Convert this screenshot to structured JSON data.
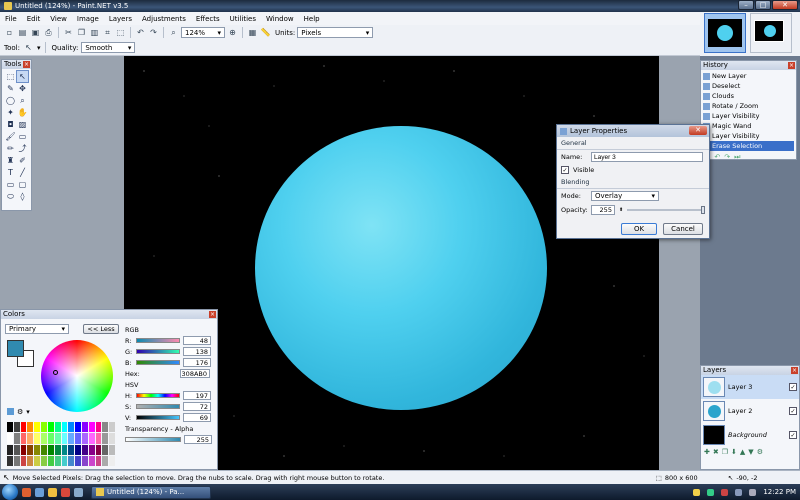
{
  "window": {
    "title": "Untitled (124%) - Paint.NET v3.5",
    "min": "–",
    "max": "□",
    "close": "✕"
  },
  "menu": [
    "File",
    "Edit",
    "View",
    "Image",
    "Layers",
    "Adjustments",
    "Effects",
    "Utilities",
    "Window",
    "Help"
  ],
  "toolbar": {
    "zoom": "124%",
    "units_label": "Units:",
    "units_value": "Pixels"
  },
  "toolbar2": {
    "tool_label": "Tool:",
    "quality_label": "Quality:",
    "quality_value": "Smooth"
  },
  "tools": {
    "title": "Tools"
  },
  "history": {
    "title": "History",
    "items": [
      "New Layer",
      "Deselect",
      "Clouds",
      "Rotate / Zoom",
      "Layer Visibility",
      "Magic Wand",
      "Layer Visibility",
      "Erase Selection"
    ]
  },
  "dialog": {
    "title": "Layer Properties",
    "general": "General",
    "name_label": "Name:",
    "name_value": "Layer 3",
    "visible_label": "Visible",
    "blending": "Blending",
    "mode_label": "Mode:",
    "mode_value": "Overlay",
    "opacity_label": "Opacity:",
    "opacity_value": "255",
    "opacity_level": 1.0,
    "ok": "OK",
    "cancel": "Cancel"
  },
  "colors": {
    "title": "Colors",
    "primary": "Primary",
    "less": "<< Less",
    "rgb": "RGB",
    "r_label": "R:",
    "r": "48",
    "g_label": "G:",
    "g": "138",
    "b_label": "B:",
    "b": "176",
    "hex_label": "Hex:",
    "hex": "308AB0",
    "hsv": "HSV",
    "h_label": "H:",
    "h": "197",
    "s_label": "S:",
    "s": "72",
    "v_label": "V:",
    "v": "69",
    "transparency": "Transparency - Alpha",
    "alpha": "255",
    "primary_color": "#308AB0"
  },
  "layers": {
    "title": "Layers",
    "items": [
      {
        "name": "Layer 3"
      },
      {
        "name": "Layer 2"
      },
      {
        "name": "Background"
      }
    ]
  },
  "status": {
    "message": "Move Selected Pixels: Drag the selection to move. Drag the nubs to scale. Drag with right mouse button to rotate.",
    "size": "800 x 600",
    "coords": "-90, -2"
  },
  "taskbar": {
    "app": "Untitled (124%) - Pa...",
    "clock": "12:22 PM"
  }
}
